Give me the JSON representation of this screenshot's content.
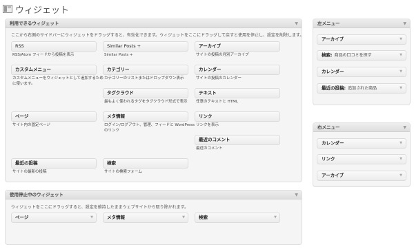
{
  "page": {
    "title": "ウィジェット"
  },
  "available": {
    "title": "利用できるウィジェット",
    "description": "ここから右側のサイドバーにウィジェットをドラッグすると、有効化できます。ウィジェットをここにドラッグして戻すと使用を停止し、設定を削除します。",
    "widgets": [
      {
        "label": "RSS",
        "desc": "RSS/Atom フィードから投稿を表示"
      },
      {
        "label": "Similar Posts +",
        "desc": "Similar Posts +"
      },
      {
        "label": "アーカイブ",
        "desc": "サイトの投稿の月別アーカイブ"
      },
      {
        "label": "カスタムメニュー",
        "desc": "カスタムメニューをウィジェットとして追加するため",
        "desc2": "に使います。"
      },
      {
        "label": "カテゴリー",
        "desc": "カテゴリーのリストまたはドロップダウン表示"
      },
      {
        "label": "カレンダー",
        "desc": "サイトの投稿のカレンダー"
      },
      {
        "label": "タグクラウド",
        "desc": "最もよく使われるタグをタグクラウド形式で表示"
      },
      {
        "label": "テキスト",
        "desc": "任意のテキストと HTML"
      },
      {
        "label": "ページ",
        "desc": "サイト内の固定ページ"
      },
      {
        "label": "メタ情報",
        "desc": "ログイン/ログアウト、管理、フィードと WordPress",
        "desc2": "のリンク"
      },
      {
        "label": "リンク",
        "desc": "リンクを表示"
      },
      {
        "label": "最近のコメント",
        "desc": "最近のコメント"
      },
      {
        "label": "最近の投稿",
        "desc": "サイトの最新の投稿"
      },
      {
        "label": "検索",
        "desc": "サイトの検索フォーム"
      }
    ]
  },
  "inactive": {
    "title": "使用停止中のウィジェット",
    "description": "ウィジェットをここにドラッグすると、設定を維持したままウェブサイトから取り除かれます。",
    "widgets": [
      {
        "label": "ページ"
      },
      {
        "label": "メタ情報"
      },
      {
        "label": "検索"
      }
    ]
  },
  "left_menu": {
    "title": "左メニュー",
    "widgets": [
      {
        "label": "アーカイブ",
        "sub": ""
      },
      {
        "label": "検索:",
        "sub": "商品の口コミを探す"
      },
      {
        "label": "カレンダー",
        "sub": ""
      },
      {
        "label": "最近の投稿:",
        "sub": "追加された商品"
      }
    ]
  },
  "right_menu": {
    "title": "右メニュー",
    "widgets": [
      {
        "label": "カレンダー",
        "sub": ""
      },
      {
        "label": "リンク",
        "sub": ""
      },
      {
        "label": "アーカイブ",
        "sub": ""
      }
    ]
  },
  "icons": {
    "toggle": "triangle-down-icon",
    "widget_arrow": "triangle-down-icon",
    "page": "widgets-screen-icon"
  }
}
